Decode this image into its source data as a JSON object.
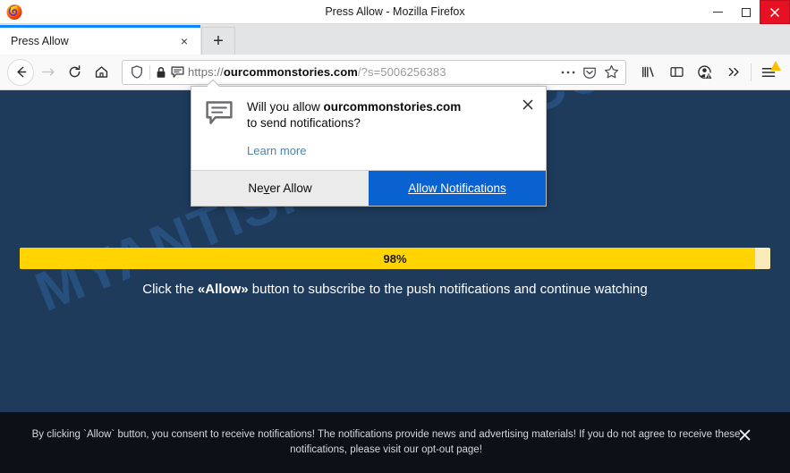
{
  "window": {
    "title": "Press Allow - Mozilla Firefox",
    "logo_icon": "firefox-logo",
    "minimize_label": "Minimize",
    "maximize_label": "Maximize",
    "close_label": "Close"
  },
  "tabs": {
    "active": {
      "title": "Press Allow",
      "close_label": "×"
    },
    "new_tab_label": "+"
  },
  "toolbar": {
    "back_icon": "back-arrow-icon",
    "forward_icon": "forward-arrow-icon",
    "reload_icon": "reload-icon",
    "home_icon": "home-icon",
    "library_icon": "library-icon",
    "sidebar_icon": "sidebar-icon",
    "account_icon": "account-warning-icon",
    "overflow_icon": "double-chevron-right-icon",
    "menu_icon": "hamburger-menu-icon"
  },
  "urlbar": {
    "shield_icon": "tracking-protection-shield-icon",
    "lock_icon": "padlock-icon",
    "permission_icon": "notification-bubble-icon",
    "scheme": "https://",
    "host": "ourcommonstories.com",
    "path_query": "/?s=5006256383",
    "page_actions_icon": "ellipsis-icon",
    "pocket_icon": "pocket-icon",
    "bookmark_icon": "star-icon"
  },
  "permission_popup": {
    "icon": "notification-bubble-icon",
    "question_prefix": "Will you allow ",
    "question_domain": "ourcommonstories.com",
    "question_suffix": "to send notifications?",
    "learn_more": "Learn more",
    "close_label": "×",
    "deny_label_pre": "Ne",
    "deny_label_key": "v",
    "deny_label_post": "er Allow",
    "allow_label": "Allow Notifications"
  },
  "page": {
    "background_color": "#1e3b5c",
    "watermark": "MYANTISPYWARE.COM",
    "watermark_color": "#2f5d93",
    "progress": {
      "percent": 98,
      "label": "98%",
      "fill_color": "#ffd400",
      "track_color": "#faebb8"
    },
    "cta_prefix": "Click the ",
    "cta_bold": "«Allow»",
    "cta_suffix": " button to subscribe to the push notifications and continue watching"
  },
  "consent_banner": {
    "text_1": "By clicking `Allow` button, you consent to receive notifications! The notifications provide news and advertising materials! If you do not agree to receive these notifications, please visit our ",
    "link": "opt-out page",
    "text_2": "!",
    "close_label": "×",
    "background_color": "#0d1117"
  }
}
